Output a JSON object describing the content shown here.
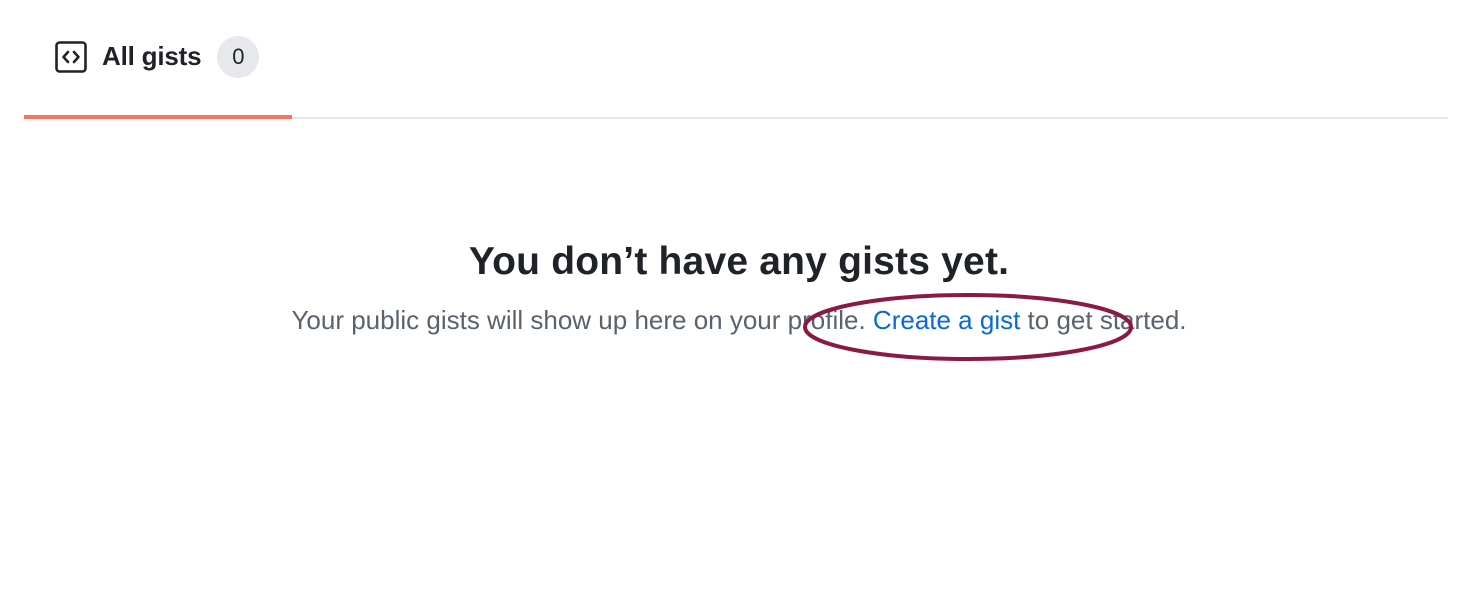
{
  "tabs": [
    {
      "label": "All gists",
      "count": "0",
      "icon": "code-square-icon",
      "selected": true
    }
  ],
  "empty_state": {
    "title": "You don’t have any gists yet.",
    "text_before": "Your public gists will show up here on your profile. ",
    "link_text": "Create a gist",
    "text_after": " to get started."
  },
  "colors": {
    "tab_underline": "#f2765d",
    "link": "#0969da",
    "annotation_ellipse": "#8a1a45",
    "counter_bg": "#e6e8eb"
  }
}
